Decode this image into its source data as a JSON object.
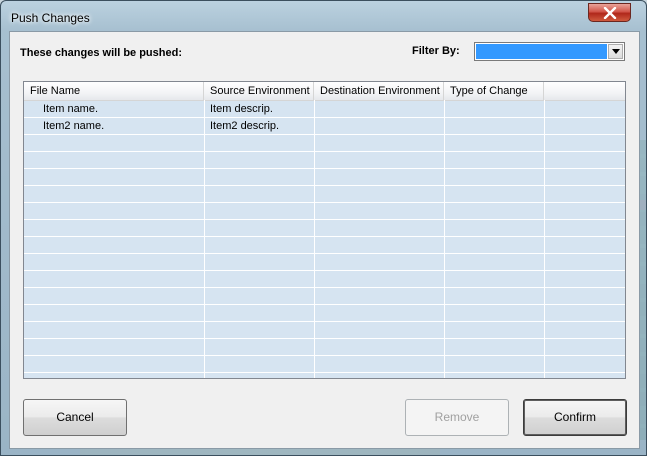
{
  "window": {
    "title": "Push Changes"
  },
  "heading": "These changes will be pushed:",
  "filter": {
    "label": "Filter By:",
    "selected_value": ""
  },
  "table": {
    "columns": [
      "File Name",
      "Source Environment",
      "Destination Environment",
      "Type of Change"
    ],
    "rows": [
      {
        "file_name": "Item name.",
        "source_env": "Item descrip.",
        "destination_env": "",
        "type_of_change": ""
      },
      {
        "file_name": "Item2 name.",
        "source_env": "Item2 descrip.",
        "destination_env": "",
        "type_of_change": ""
      }
    ]
  },
  "buttons": {
    "cancel": "Cancel",
    "remove": "Remove",
    "confirm": "Confirm"
  },
  "icons": {
    "close": "close-icon",
    "dropdown": "chevron-down-icon"
  },
  "colors": {
    "list_background": "#d6e4f1",
    "selection_blue": "#3399ff",
    "close_red": "#c8372a"
  }
}
